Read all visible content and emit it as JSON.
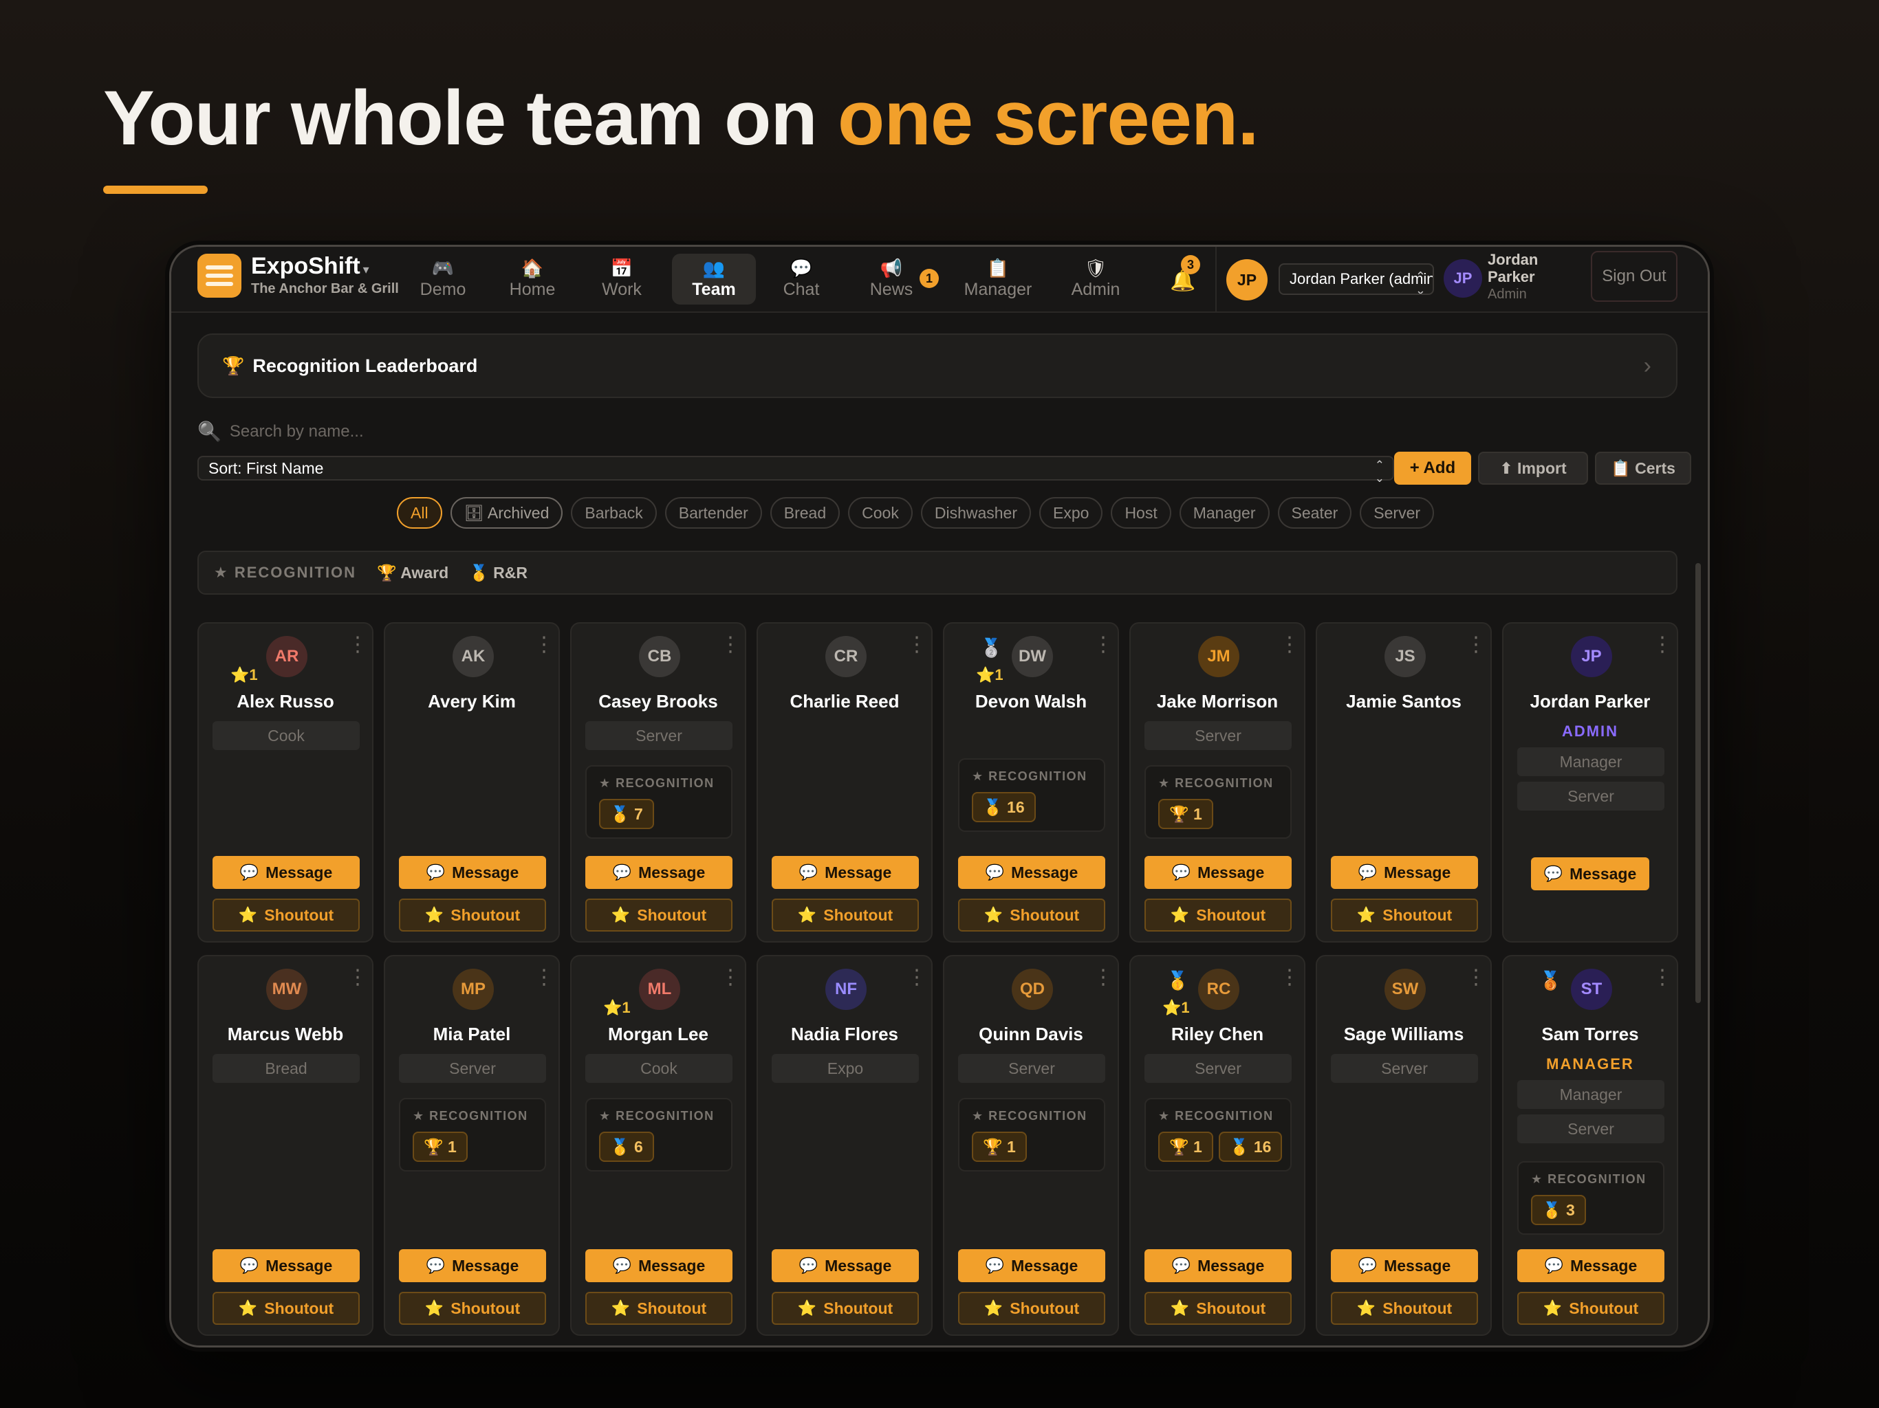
{
  "headline": {
    "main": "Your whole team on ",
    "accent": "one screen."
  },
  "app": {
    "brand": "ExpoShift",
    "brand_caret": "▾",
    "location": "The Anchor Bar & Grill",
    "nav": [
      {
        "label": "Demo",
        "icon": "🎮"
      },
      {
        "label": "Home",
        "icon": "🏠"
      },
      {
        "label": "Work",
        "icon": "📅"
      },
      {
        "label": "Team",
        "icon": "👥"
      },
      {
        "label": "Chat",
        "icon": "💬"
      },
      {
        "label": "News",
        "icon": "📢",
        "badge": "1"
      },
      {
        "label": "Manager",
        "icon": "📋"
      },
      {
        "label": "Admin",
        "icon": "🛡"
      }
    ],
    "notifications": {
      "icon": "🔔",
      "badge": "3"
    },
    "user": {
      "initials": "JP",
      "select_value": "Jordan Parker (admin)",
      "name": "Jordan Parker",
      "role": "Admin",
      "sign_out": "Sign Out"
    }
  },
  "leaderboard": {
    "icon": "🏆",
    "title": "Recognition Leaderboard",
    "chevron": "›"
  },
  "search": {
    "icon": "🔍",
    "placeholder": "Search by name..."
  },
  "toolbar": {
    "sort_value": "Sort: First Name",
    "add": "+ Add",
    "import": "⬆ Import",
    "certs": "📋 Certs"
  },
  "filters": [
    "All",
    "🗄 Archived",
    "Barback",
    "Bartender",
    "Bread",
    "Cook",
    "Dishwasher",
    "Expo",
    "Host",
    "Manager",
    "Seater",
    "Server"
  ],
  "recognition_bar": {
    "label": "★ RECOGNITION",
    "award": "🏆 Award",
    "rr": "🥇 R&R"
  },
  "card_labels": {
    "recognition": "★ RECOGNITION",
    "message": "Message",
    "shoutout": "Shoutout",
    "message_icon": "💬",
    "shoutout_icon": "⭐",
    "menu": "⋮"
  },
  "colors": {
    "accent": "#f2a02b",
    "admin": "#8a6bff"
  },
  "members": [
    {
      "initials": "AR",
      "name": "Alex Russo",
      "roles": [
        "Cook"
      ],
      "star": "⭐1",
      "av_bg": "#4a2a28",
      "av_fg": "#f07a6a"
    },
    {
      "initials": "AK",
      "name": "Avery Kim",
      "roles": [],
      "av_bg": "#3a3836",
      "av_fg": "#bdb8b1"
    },
    {
      "initials": "CB",
      "name": "Casey Brooks",
      "roles": [
        "Server"
      ],
      "recognition": [
        "🥇 7"
      ],
      "av_bg": "#3a3836",
      "av_fg": "#bdb8b1"
    },
    {
      "initials": "CR",
      "name": "Charlie Reed",
      "roles": [],
      "av_bg": "#3a3836",
      "av_fg": "#bdb8b1"
    },
    {
      "initials": "DW",
      "name": "Devon Walsh",
      "roles": [],
      "medal": "🥈",
      "star": "⭐1",
      "recognition": [
        "🥇 16"
      ],
      "av_bg": "#3a3836",
      "av_fg": "#bdb8b1"
    },
    {
      "initials": "JM",
      "name": "Jake Morrison",
      "roles": [
        "Server"
      ],
      "recognition": [
        "🏆 1"
      ],
      "av_bg": "#5a3c12",
      "av_fg": "#f2a02b"
    },
    {
      "initials": "JS",
      "name": "Jamie Santos",
      "roles": [],
      "av_bg": "#3a3836",
      "av_fg": "#bdb8b1"
    },
    {
      "initials": "JP",
      "name": "Jordan Parker",
      "title": "ADMIN",
      "roles": [
        "Manager",
        "Server"
      ],
      "av_bg": "#2a1f55",
      "av_fg": "#a48bff"
    },
    {
      "initials": "MW",
      "name": "Marcus Webb",
      "roles": [
        "Bread"
      ],
      "av_bg": "#4a3020",
      "av_fg": "#e08a50"
    },
    {
      "initials": "MP",
      "name": "Mia Patel",
      "roles": [
        "Server"
      ],
      "recognition": [
        "🏆 1"
      ],
      "av_bg": "#4a3418",
      "av_fg": "#e69a3a"
    },
    {
      "initials": "ML",
      "name": "Morgan Lee",
      "roles": [
        "Cook"
      ],
      "star": "⭐1",
      "recognition": [
        "🥇 6"
      ],
      "av_bg": "#4a2a28",
      "av_fg": "#f07a6a"
    },
    {
      "initials": "NF",
      "name": "Nadia Flores",
      "roles": [
        "Expo"
      ],
      "av_bg": "#2d2a55",
      "av_fg": "#9a8cff"
    },
    {
      "initials": "QD",
      "name": "Quinn Davis",
      "roles": [
        "Server"
      ],
      "recognition": [
        "🏆 1"
      ],
      "av_bg": "#4a3418",
      "av_fg": "#e69a3a"
    },
    {
      "initials": "RC",
      "name": "Riley Chen",
      "roles": [
        "Server"
      ],
      "medal": "🥇",
      "star": "⭐1",
      "recognition": [
        "🏆 1",
        "🥇 16"
      ],
      "av_bg": "#4a3418",
      "av_fg": "#e69a3a"
    },
    {
      "initials": "SW",
      "name": "Sage Williams",
      "roles": [
        "Server"
      ],
      "av_bg": "#4a3418",
      "av_fg": "#e69a3a"
    },
    {
      "initials": "ST",
      "name": "Sam Torres",
      "title": "MANAGER",
      "roles": [
        "Manager",
        "Server"
      ],
      "medal": "🥉",
      "recognition": [
        "🥇 3"
      ],
      "av_bg": "#2a1f55",
      "av_fg": "#a48bff"
    }
  ]
}
